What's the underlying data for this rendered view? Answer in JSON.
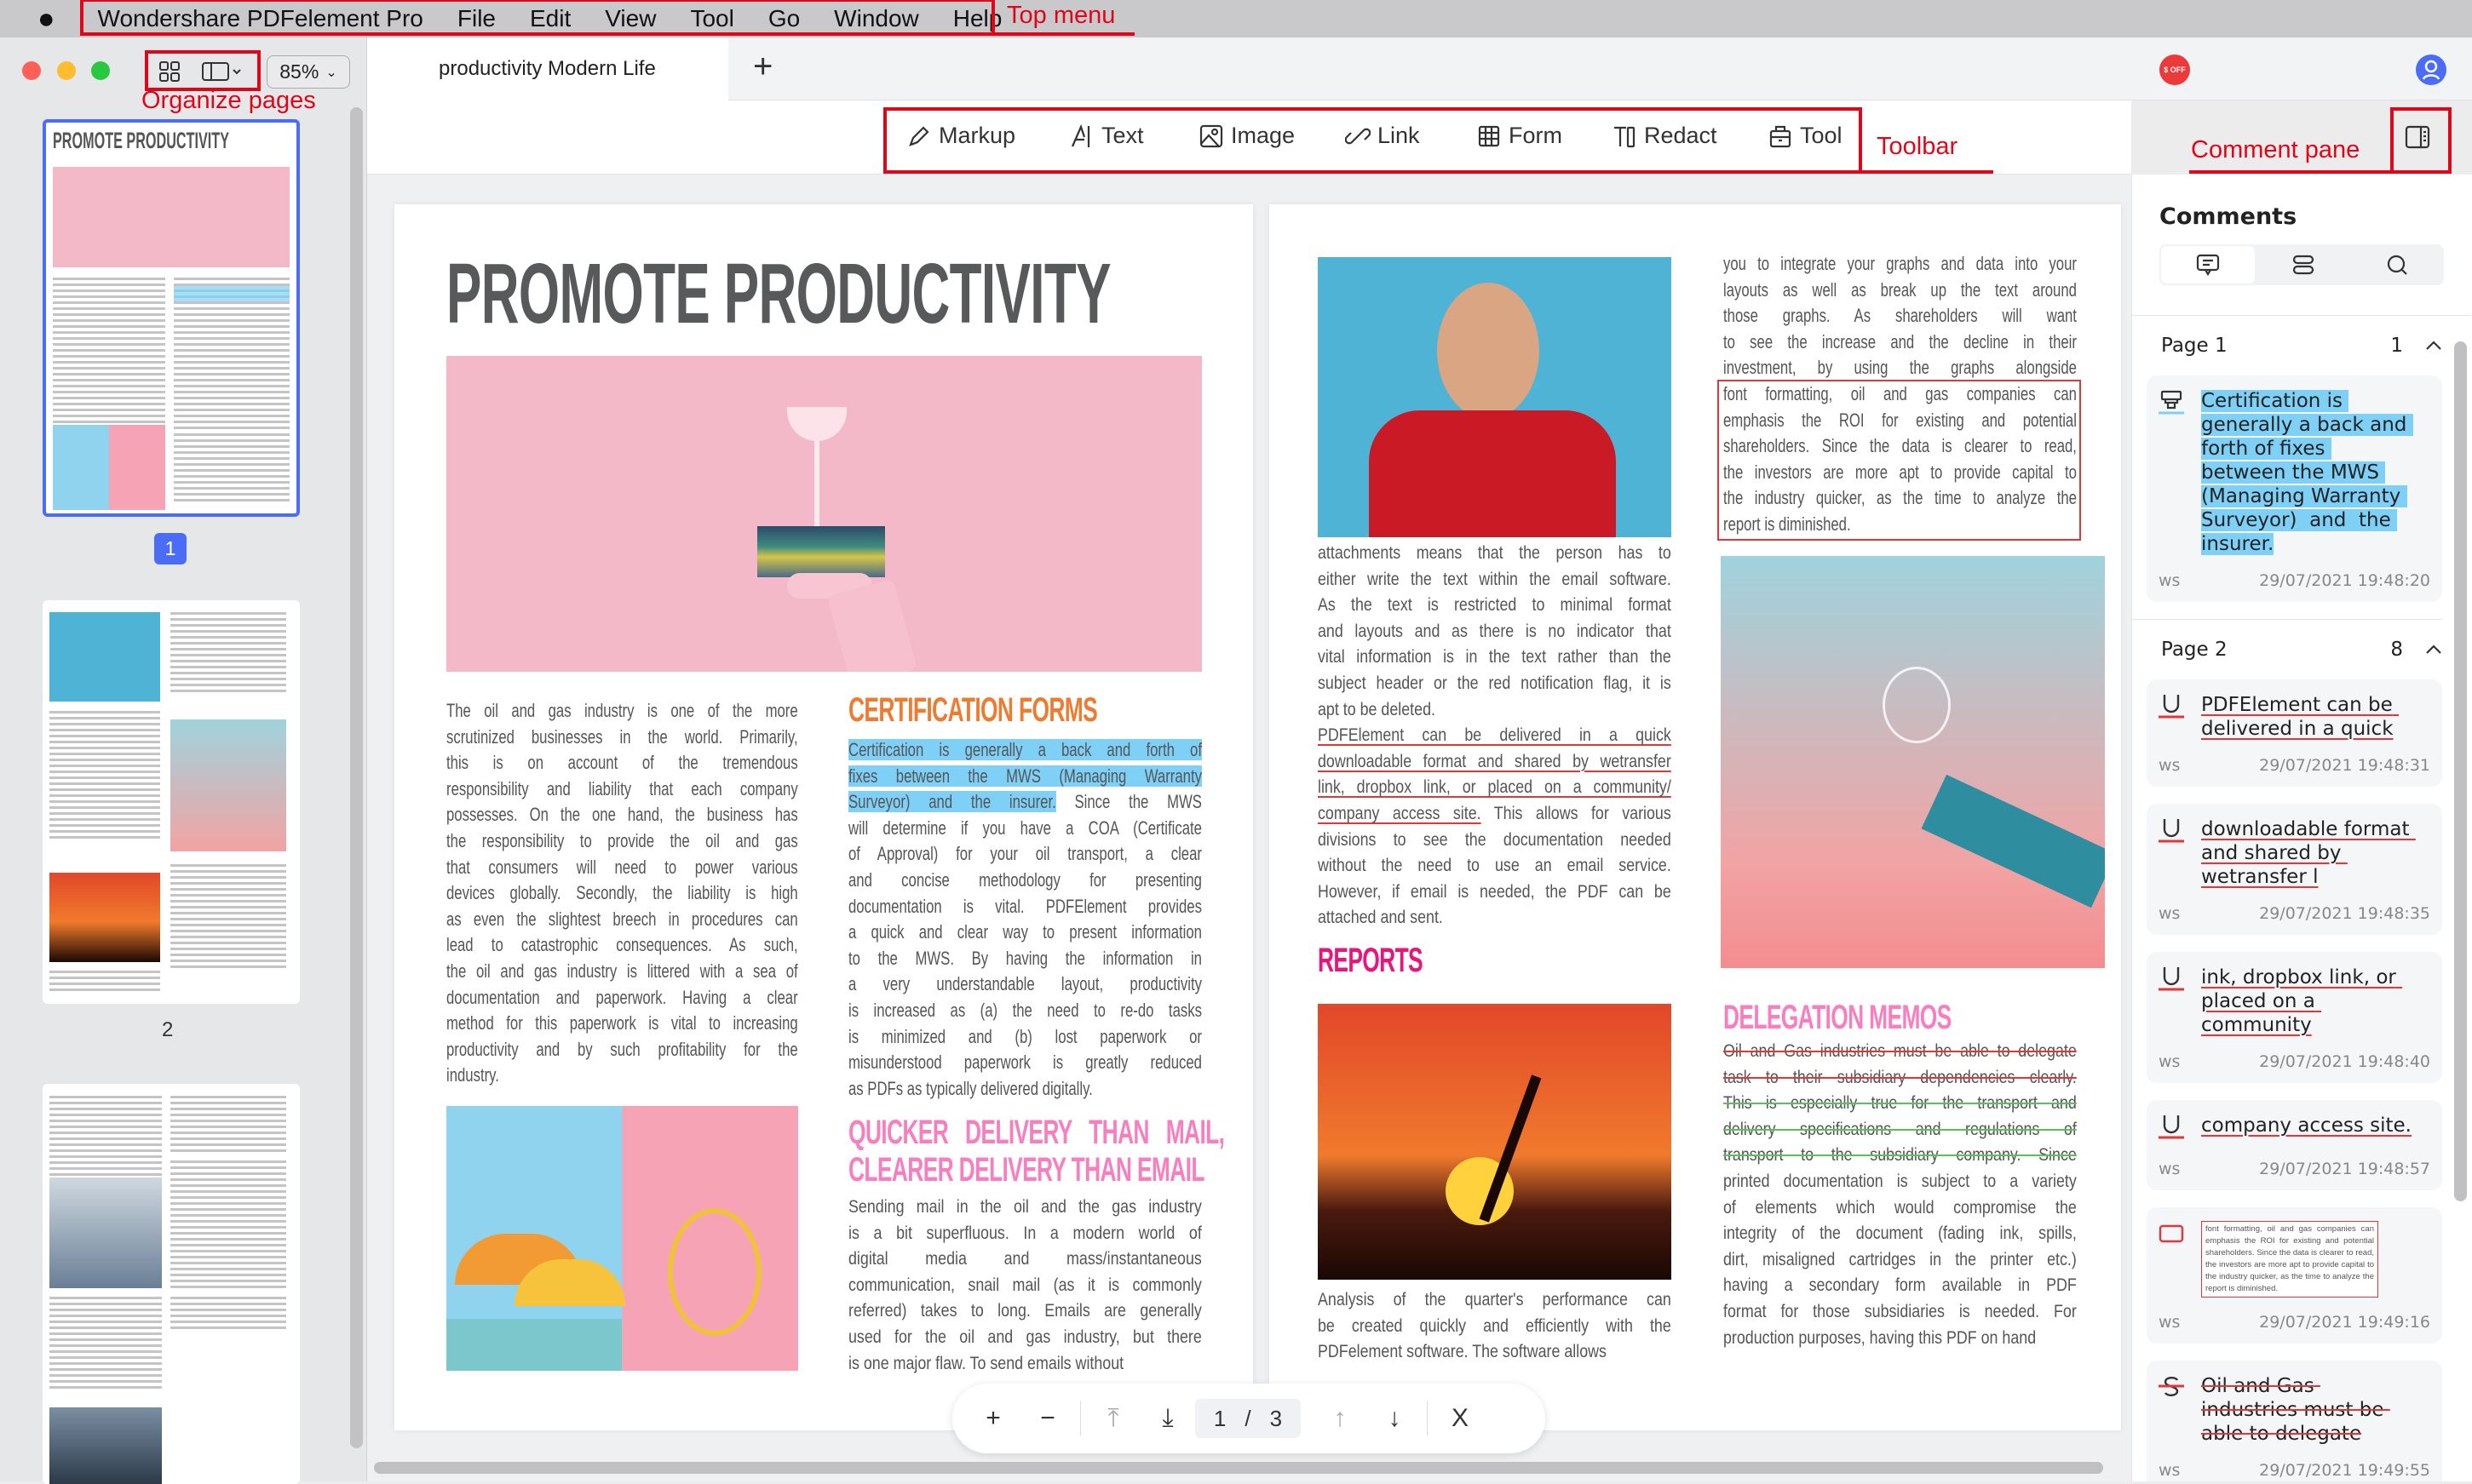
{
  "menubar": {
    "apple_icon": "apple-logo-icon",
    "app_name": "Wondershare PDFelement Pro",
    "items": [
      "File",
      "Edit",
      "View",
      "Tool",
      "Go",
      "Window",
      "Help"
    ]
  },
  "annotations": {
    "top_menu": "Top menu",
    "organize_pages": "Organize pages",
    "toolbar": "Toolbar",
    "comment_pane": "Comment pane",
    "color": "#e0061a"
  },
  "window": {
    "zoom": "85%",
    "tab_title": "productivity Modern Life",
    "new_tab": "+",
    "promo_badge": "$ OFF",
    "promo_icon": "discount-badge-icon",
    "account_icon": "user-avatar-icon"
  },
  "toolbar": {
    "items": [
      {
        "label": "Markup",
        "icon": "pen-icon"
      },
      {
        "label": "Text",
        "icon": "text-icon"
      },
      {
        "label": "Image",
        "icon": "image-icon"
      },
      {
        "label": "Link",
        "icon": "link-icon"
      },
      {
        "label": "Form",
        "icon": "table-icon"
      },
      {
        "label": "Redact",
        "icon": "redact-icon"
      },
      {
        "label": "Tool",
        "icon": "toolbox-icon"
      }
    ]
  },
  "thumbnails": {
    "pages": [
      "1",
      "2"
    ],
    "selected": "1",
    "accent": "#4a6cf7"
  },
  "page1": {
    "title": "PROMOTE PRODUCTIVITY",
    "left_column": {
      "paragraphs": [
        [
          "The oil and gas industry is one of the more",
          "scrutinized businesses in the world. Primarily,",
          "this is on account of the tremendous",
          "responsibility and liability that each company",
          "possesses. On the one hand, the business has",
          "the responsibility to provide the oil and gas",
          "that consumers will need to power various",
          "devices globally. Secondly, the liability is high",
          "as even the slightest breech in procedures can",
          "lead to catastrophic consequences. As such,",
          "the oil and gas industry is littered with a sea of",
          "documentation and paperwork. Having a clear",
          "method for this paperwork is vital to increasing",
          "productivity and by such profitability for the",
          "industry."
        ]
      ]
    },
    "cert_heading": "CERTIFICATION FORMS",
    "cert_column": {
      "paragraphs": [
        [
          {
            "text": "Certification is generally a back and forth of",
            "mark": "hl"
          },
          {
            "text": "fixes between the MWS (Managing Warranty",
            "mark": "hl"
          },
          [
            {
              "text": "Surveyor) and the insurer.",
              "mark": "hl"
            },
            {
              "text": " Since the MWS"
            }
          ],
          "will determine if you have a COA (Certificate",
          "of Approval) for your oil transport, a clear",
          "and concise methodology for presenting",
          "documentation is vital. PDFElement provides",
          "a quick and clear way to present information",
          "to the MWS. By having the information in",
          "a very understandable layout, productivity",
          "is increased as (a) the need to re-do tasks",
          "is minimized and (b) lost paperwork or",
          "misunderstood paperwork is greatly reduced",
          "as PDFs as typically delivered digitally."
        ]
      ]
    },
    "quick_heading": [
      "QUICKER DELIVERY THAN MAIL,",
      "CLEARER DELIVERY THAN EMAIL"
    ],
    "sending_column": {
      "paragraphs": [
        [
          "Sending mail in the oil and the gas industry",
          "is a bit superfluous. In a modern world of",
          "digital media and mass/instantaneous",
          "communication, snail mail (as it is commonly",
          "referred) takes to long. Emails are generally",
          "used for the oil and gas industry, but there",
          "is one major flaw. To send emails without"
        ]
      ]
    }
  },
  "page2": {
    "top_right_column": {
      "paragraphs": [
        [
          "you to integrate your graphs and data into your",
          "layouts as well as break up the text around",
          "those graphs. As shareholders will want",
          "to see the increase and the decline in their",
          "investment, by using the graphs alongside",
          "font formatting, oil and gas companies can",
          "emphasis the ROI for existing and potential",
          "shareholders. Since the data is clearer to read,",
          "the investors are more apt to provide capital to",
          "the industry quicker, as the time to analyze the",
          "report is diminished."
        ]
      ]
    },
    "mid_column": {
      "paragraphs": [
        [
          "attachments means that the person has to",
          "either write the text within the email software.",
          "As the text is restricted to minimal format",
          "and layouts and as there is no indicator that",
          "vital information is in the text rather than the",
          "subject header or the red notification flag, it is",
          "apt to be deleted."
        ],
        [
          {
            "text": "PDFElement can be delivered in a quick",
            "mark": "ul"
          },
          {
            "text": "downloadable format and shared by wetransfer",
            "mark": "ul"
          },
          {
            "text": "link, dropbox link, or placed on a community/",
            "mark": "ul"
          },
          [
            {
              "text": "company access site.",
              "mark": "ul"
            },
            {
              "text": " This allows for various"
            }
          ],
          "divisions to see the documentation needed",
          "without the need to use an email service.",
          "However, if email is needed, the PDF can be",
          "attached and sent."
        ]
      ]
    },
    "reports_heading": "REPORTS",
    "analysis_column": {
      "paragraphs": [
        [
          "Analysis of the quarter's performance can",
          "be created quickly and efficiently with the",
          "PDFelement software. The software allows"
        ]
      ]
    },
    "delegation_heading": "DELEGATION MEMOS",
    "delegation_column": {
      "paragraphs": [
        [
          {
            "text": "Oil and Gas industries must be able to delegate",
            "mark": "st-red"
          },
          {
            "text": "task to their subsidiary dependencies clearly.",
            "mark": "st-red"
          },
          {
            "text": "This is especially true for the transport and",
            "mark": "st-green"
          },
          {
            "text": "delivery specifications and regulations of",
            "mark": "st-green"
          },
          {
            "text": "transport to the subsidiary company. Since",
            "mark": "st-green"
          },
          "printed documentation is subject to a variety",
          "of elements which would compromise the",
          "integrity of the document (fading ink, spills,",
          "dirt, misaligned cartridges in the printer etc.)",
          "having a secondary form available in PDF",
          "format for those subsidiaries is needed. For",
          "production purposes, having this PDF on hand"
        ]
      ]
    }
  },
  "comments": {
    "title": "Comments",
    "tabs": [
      "comment-list-icon",
      "group-icon",
      "search-icon"
    ],
    "groups": [
      {
        "label": "Page 1",
        "count": "1",
        "items": [
          {
            "type": "highlight",
            "text": "Certification is generally a back and forth of fixes between the MWS (Managing Warranty Surveyor)  and  the insurer.",
            "author": "ws",
            "time": "29/07/2021 19:48:20"
          }
        ]
      },
      {
        "label": "Page 2",
        "count": "8",
        "items": [
          {
            "type": "underline",
            "text": "PDFElement can be delivered in a quick",
            "author": "ws",
            "time": "29/07/2021 19:48:31"
          },
          {
            "type": "underline",
            "text": "downloadable format and shared by wetransfer l",
            "author": "ws",
            "time": "29/07/2021 19:48:35"
          },
          {
            "type": "underline",
            "text": "ink, dropbox link, or placed on a community",
            "author": "ws",
            "time": "29/07/2021 19:48:40"
          },
          {
            "type": "underline",
            "text": "company access site.",
            "author": "ws",
            "time": "29/07/2021 19:48:57"
          },
          {
            "type": "area",
            "text": "font formatting, oil and gas companies can emphasis the ROI for existing and potential shareholders. Since the data is clearer to read, the investors are more apt to provide capital to the industry quicker, as the time to analyze the report is diminished.",
            "author": "ws",
            "time": "29/07/2021 19:49:16"
          },
          {
            "type": "strikeout",
            "text": "Oil and Gas industries must be able to delegate",
            "author": "ws",
            "time": "29/07/2021 19:49:55"
          }
        ]
      }
    ]
  },
  "page_nav": {
    "zoom_in": "+",
    "zoom_out": "−",
    "current": "1",
    "separator": "/",
    "total": "3",
    "close": "X"
  },
  "colors": {
    "highlight": "#7fd0f7",
    "underline": "#e2363b",
    "strike_green": "#5bbf5b",
    "orange_heading": "#ee7b30",
    "pink_heading": "#f77fbf",
    "magenta_heading": "#e8157c"
  }
}
